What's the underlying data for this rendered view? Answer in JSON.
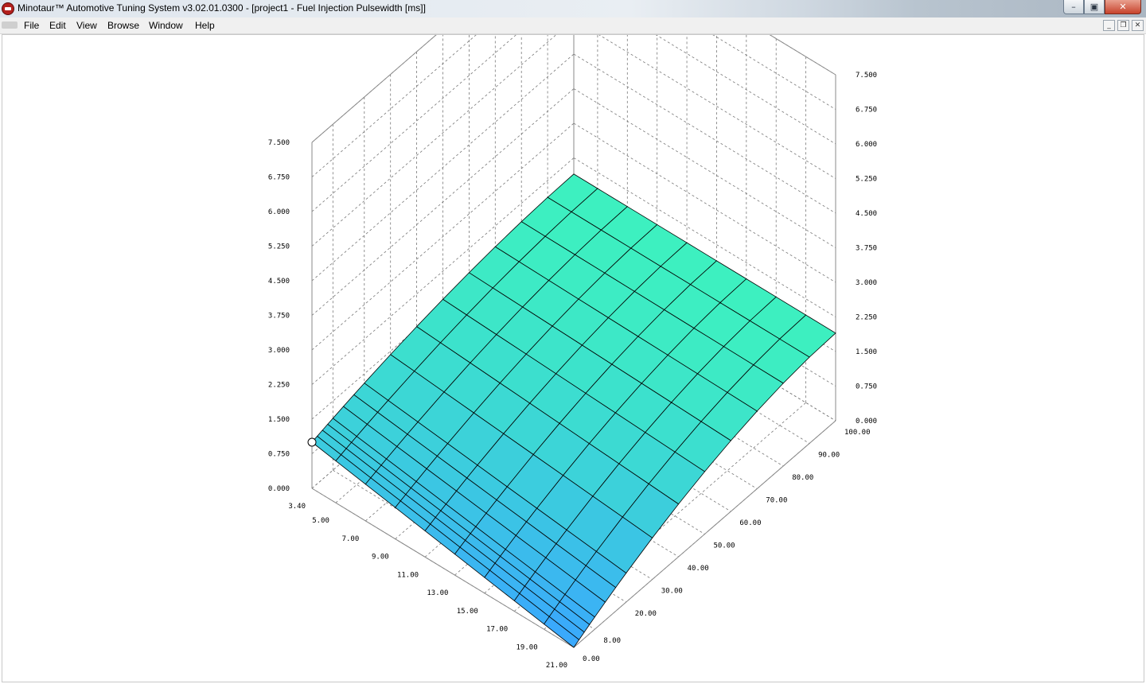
{
  "window": {
    "title": "Minotaur™ Automotive Tuning System  v3.02.01.0300 - [project1 - Fuel Injection Pulsewidth [ms]]",
    "minimize_glyph": "–",
    "maximize_glyph": "▣",
    "close_glyph": "✕"
  },
  "menu": {
    "file": "File",
    "edit": "Edit",
    "view": "View",
    "browse": "Browse",
    "window": "Window",
    "help": "Help"
  },
  "mdi_controls": {
    "minimize": "_",
    "restore": "❐",
    "close": "✕"
  },
  "chart_data": {
    "type": "surface",
    "title": "Fuel Injection Pulsewidth [ms]",
    "z_axis": {
      "range": [
        0,
        7.5
      ],
      "tick_labels": [
        "0.000",
        "0.750",
        "1.500",
        "2.250",
        "3.000",
        "3.750",
        "4.500",
        "5.250",
        "6.000",
        "6.750",
        "7.500"
      ]
    },
    "x_axis": {
      "range": [
        3.4,
        21.0
      ],
      "tick_labels": [
        "3.40",
        "5.00",
        "7.00",
        "9.00",
        "11.00",
        "13.00",
        "15.00",
        "17.00",
        "19.00",
        "21.00"
      ]
    },
    "y_axis": {
      "range": [
        0,
        100
      ],
      "tick_labels": [
        "0.00",
        "8.00",
        "20.00",
        "30.00",
        "40.00",
        "50.00",
        "60.00",
        "70.00",
        "80.00",
        "90.00",
        "100.00"
      ]
    },
    "z_values_description_free": true,
    "z_at_x_min_y_min": 1.0,
    "z_at_x_max_y_min": 0.0,
    "z_at_x_max_y_max": 1.9,
    "z_at_x_min_y_max": 1.9,
    "colors": {
      "low": "#3aa5ff",
      "high": "#3df0c0",
      "mesh": "#000000",
      "grid": "#777777"
    },
    "grid": true,
    "selected_cell_marker": "white-circle"
  }
}
